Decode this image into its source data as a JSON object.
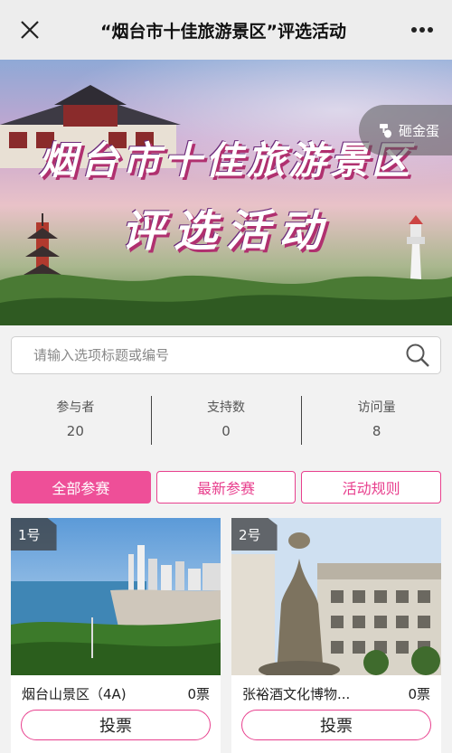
{
  "titlebar": {
    "title": "“烟台市十佳旅游景区”评选活动"
  },
  "banner": {
    "headline_line1": "烟台市十佳旅游景区",
    "headline_line2": "评选活动",
    "egg_button": "砸金蛋"
  },
  "search": {
    "placeholder": "请输入选项标题或编号"
  },
  "stats": [
    {
      "label": "参与者",
      "value": "20"
    },
    {
      "label": "支持数",
      "value": "0"
    },
    {
      "label": "访问量",
      "value": "8"
    }
  ],
  "tabs": [
    {
      "label": "全部参赛",
      "active": true
    },
    {
      "label": "最新参赛",
      "active": false
    },
    {
      "label": "活动规则",
      "active": false
    }
  ],
  "entries": [
    {
      "number": "1号",
      "name": "烟台山景区（4A)",
      "votes": "0票",
      "vote_label": "投票"
    },
    {
      "number": "2号",
      "name": "张裕酒文化博物...",
      "votes": "0票",
      "vote_label": "投票"
    }
  ],
  "colors": {
    "accent": "#ee4f98",
    "titlebar_bg": "#ededed",
    "page_bg": "#f2f2f2"
  }
}
